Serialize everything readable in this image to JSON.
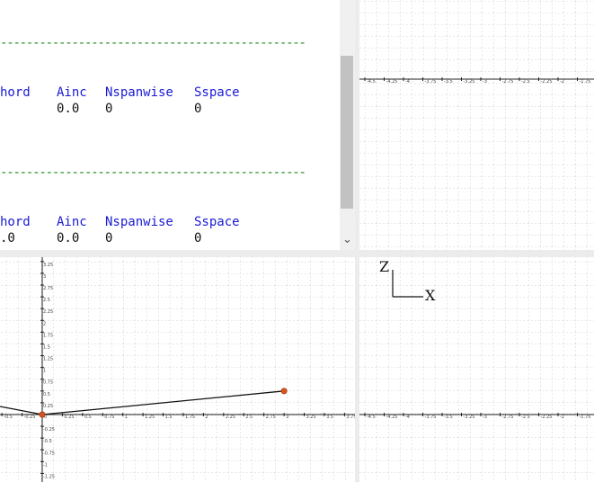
{
  "editor": {
    "separator": "-----------------------------------------------",
    "block1": {
      "headers": [
        "hord",
        "Ainc",
        "Nspanwise",
        "Sspace"
      ],
      "values": [
        "",
        "0.0",
        "0",
        "0"
      ]
    },
    "block2": {
      "headers": [
        "hord",
        "Ainc",
        "Nspanwise",
        "Sspace"
      ],
      "values": [
        ".0",
        "0.0",
        "0",
        "0"
      ]
    },
    "scroll_down_glyph": "⌄"
  },
  "views": {
    "top_right": {
      "x_ticks": [
        "-4.5",
        "-4.25",
        "-4",
        "-3.75",
        "-3.5",
        "-3.25",
        "-3",
        "-2.75",
        "-2.5",
        "-2.25",
        "-2",
        "-1.75"
      ]
    },
    "bottom_left": {
      "x_ticks": [
        "-0.5",
        "-0.25",
        "0",
        "0.25",
        "0.5",
        "0.75",
        "1",
        "1.25",
        "1.5",
        "1.75",
        "2",
        "2.25",
        "2.5",
        "2.75",
        "3",
        "3.25",
        "3.5",
        "3.75"
      ],
      "y_ticks": [
        "3.5",
        "3.25",
        "3",
        "2.75",
        "2.5",
        "2.25",
        "2",
        "1.75",
        "1.5",
        "1.25",
        "1",
        "0.75",
        "0.5",
        "0.25",
        "-0.25",
        "-0.5",
        "-0.75",
        "-1",
        "-1.25"
      ],
      "points": [
        {
          "x": 0,
          "z": 0
        },
        {
          "x": 3,
          "z": 0.5
        }
      ],
      "point_color": "#d9541e"
    },
    "bottom_right": {
      "axis_z": "Z",
      "axis_x": "X",
      "x_ticks": [
        "-4.5",
        "-4.25",
        "-4",
        "-3.75",
        "-3.5",
        "-3.25",
        "-3",
        "-2.75",
        "-2.5",
        "-2.25",
        "-2",
        "-1.75"
      ]
    }
  }
}
